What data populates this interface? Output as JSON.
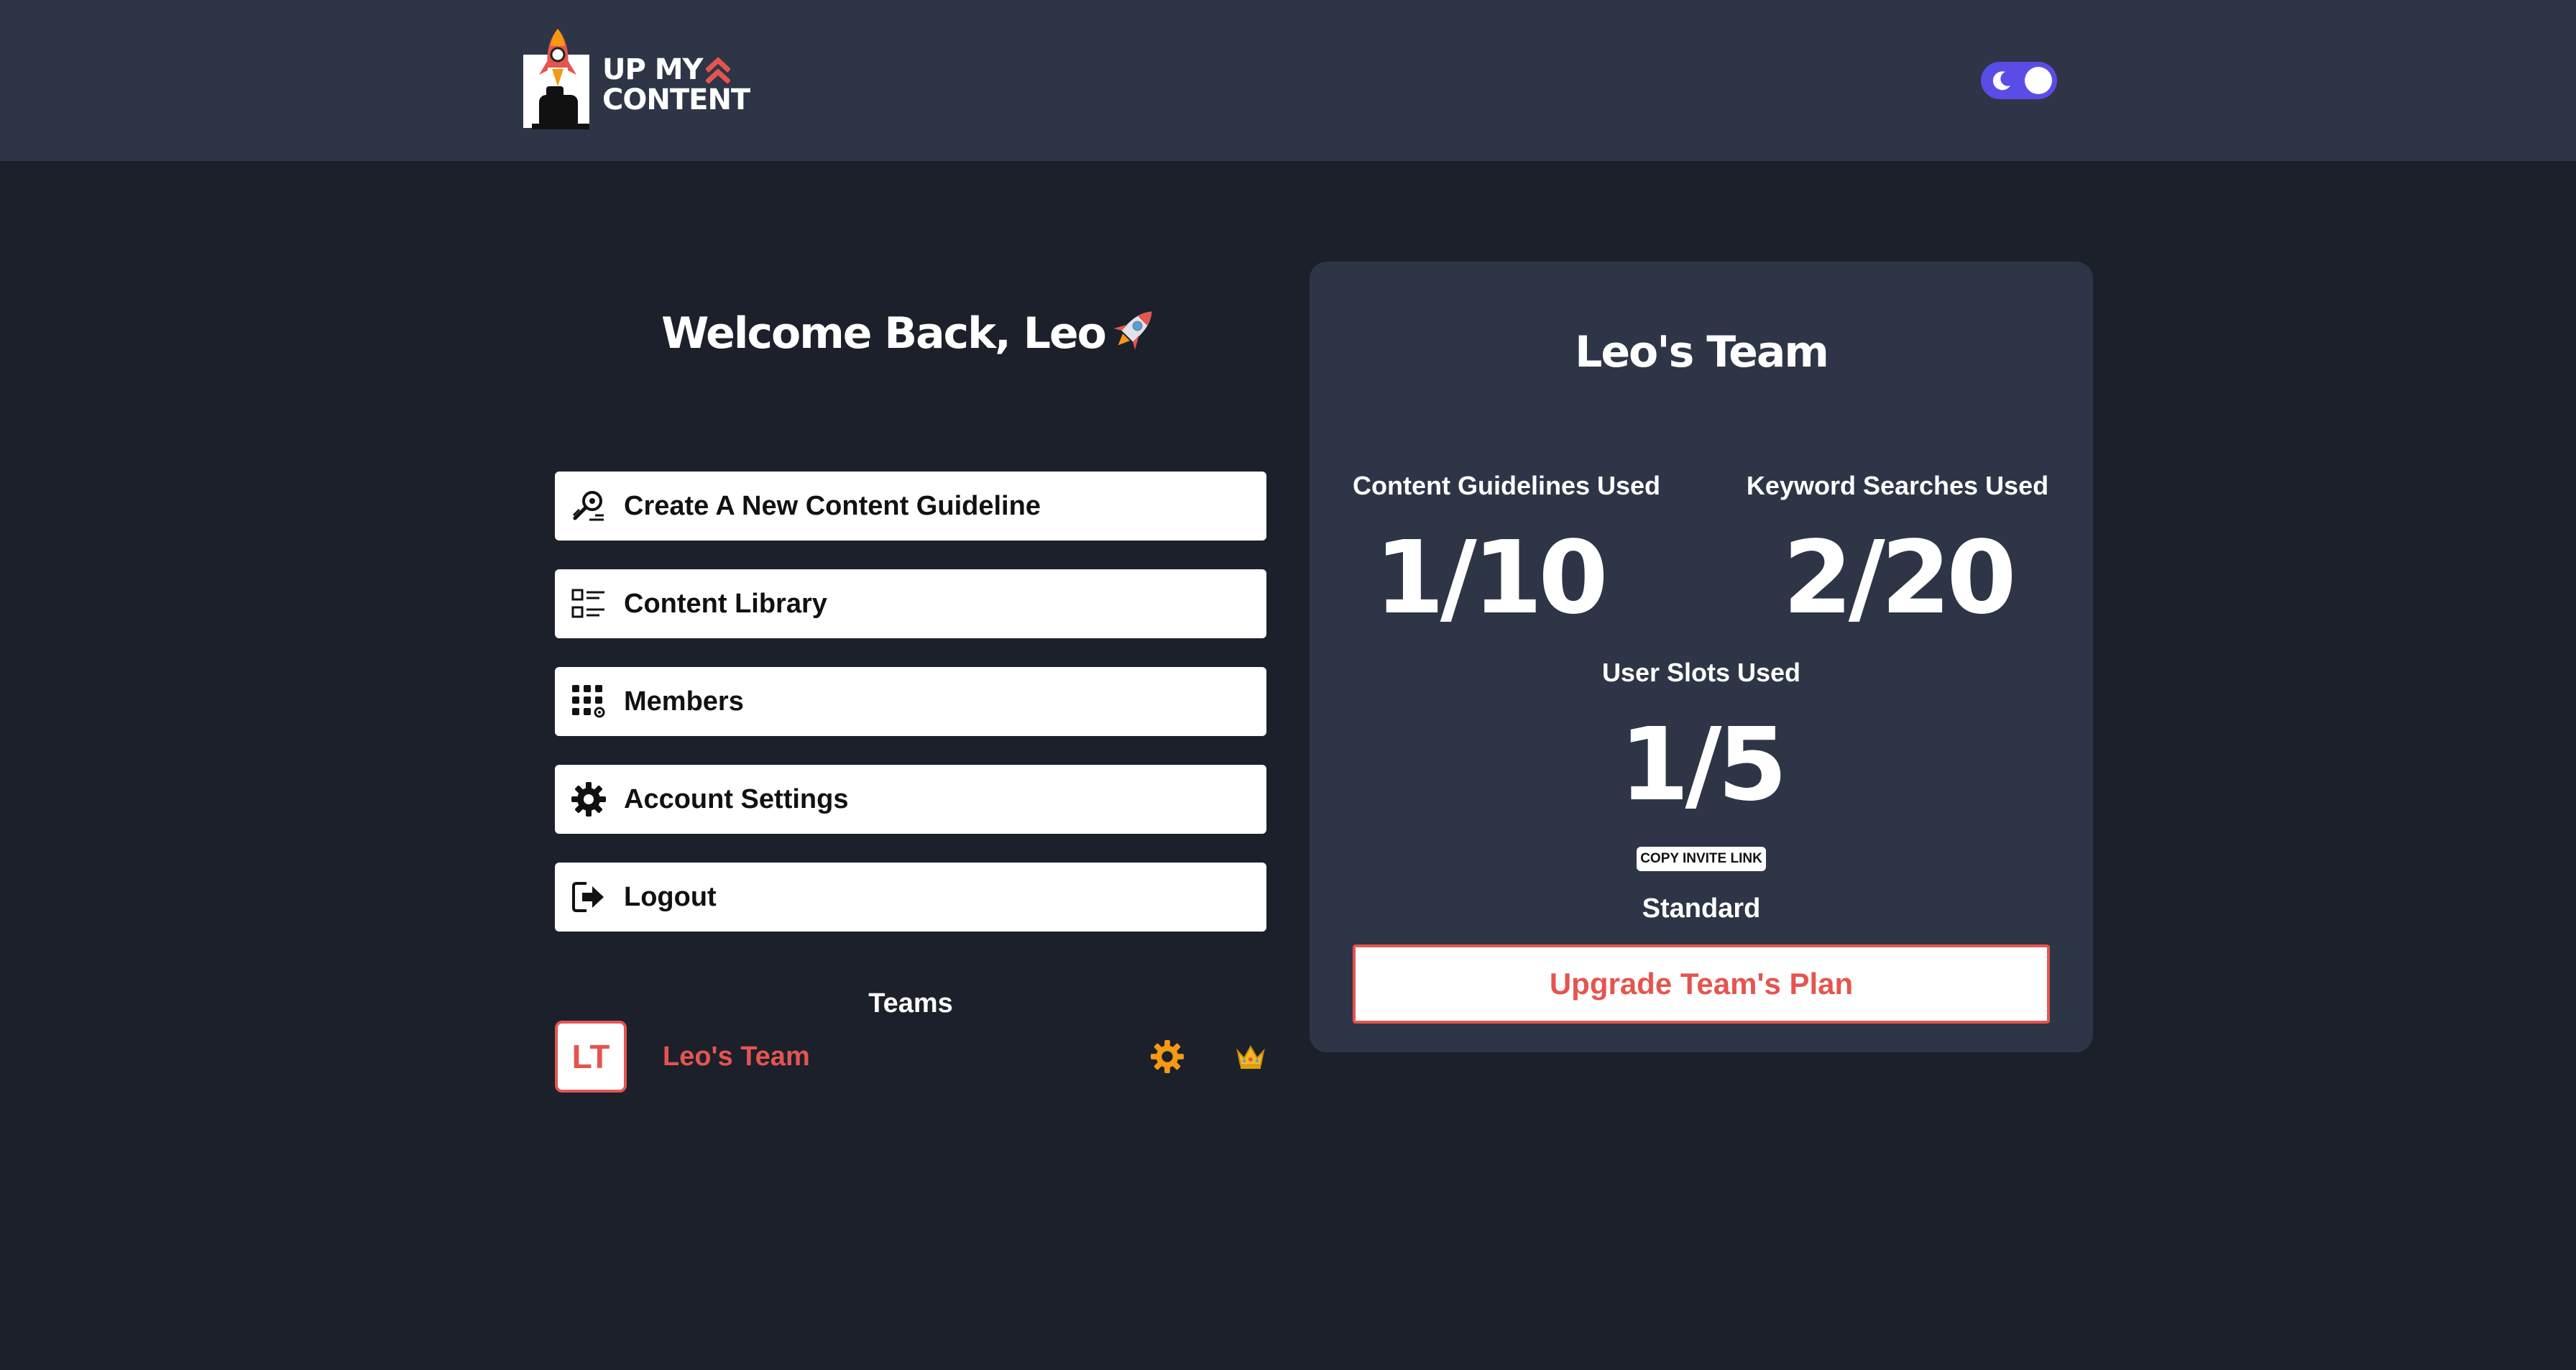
{
  "header": {
    "logo": {
      "text_line1": "UP MY",
      "text_line2": "CONTENT",
      "icon": "rocket-logo-icon"
    },
    "theme_toggle": {
      "state": "dark",
      "icon": "moon-icon",
      "accent_color": "#5a4de6"
    }
  },
  "welcome": {
    "text": "Welcome Back, Leo",
    "emoji_icon": "rocket-icon"
  },
  "menu": {
    "items": [
      {
        "label": "Create A New Content Guideline",
        "icon": "content-guideline-icon"
      },
      {
        "label": "Content Library",
        "icon": "list-icon"
      },
      {
        "label": "Members",
        "icon": "members-grid-icon"
      },
      {
        "label": "Account Settings",
        "icon": "gear-icon"
      },
      {
        "label": "Logout",
        "icon": "logout-icon"
      }
    ]
  },
  "teams": {
    "title": "Teams",
    "items": [
      {
        "initials": "LT",
        "name": "Leo's Team",
        "settings_icon": "gear-icon",
        "owner_icon": "crown-icon"
      }
    ]
  },
  "team_card": {
    "title": "Leo's Team",
    "stats": {
      "content_guidelines": {
        "label": "Content Guidelines Used",
        "value": "1/10"
      },
      "keyword_searches": {
        "label": "Keyword Searches Used",
        "value": "2/20"
      },
      "user_slots": {
        "label": "User Slots Used",
        "value": "1/5"
      }
    },
    "copy_invite_label": "COPY INVITE LINK",
    "plan": "Standard",
    "upgrade_label": "Upgrade Team's Plan"
  },
  "colors": {
    "background": "#1b202b",
    "header_bg": "#2e3546",
    "card_bg": "#2e3546",
    "accent_red": "#e5554f",
    "gear_orange": "#f59a12"
  }
}
